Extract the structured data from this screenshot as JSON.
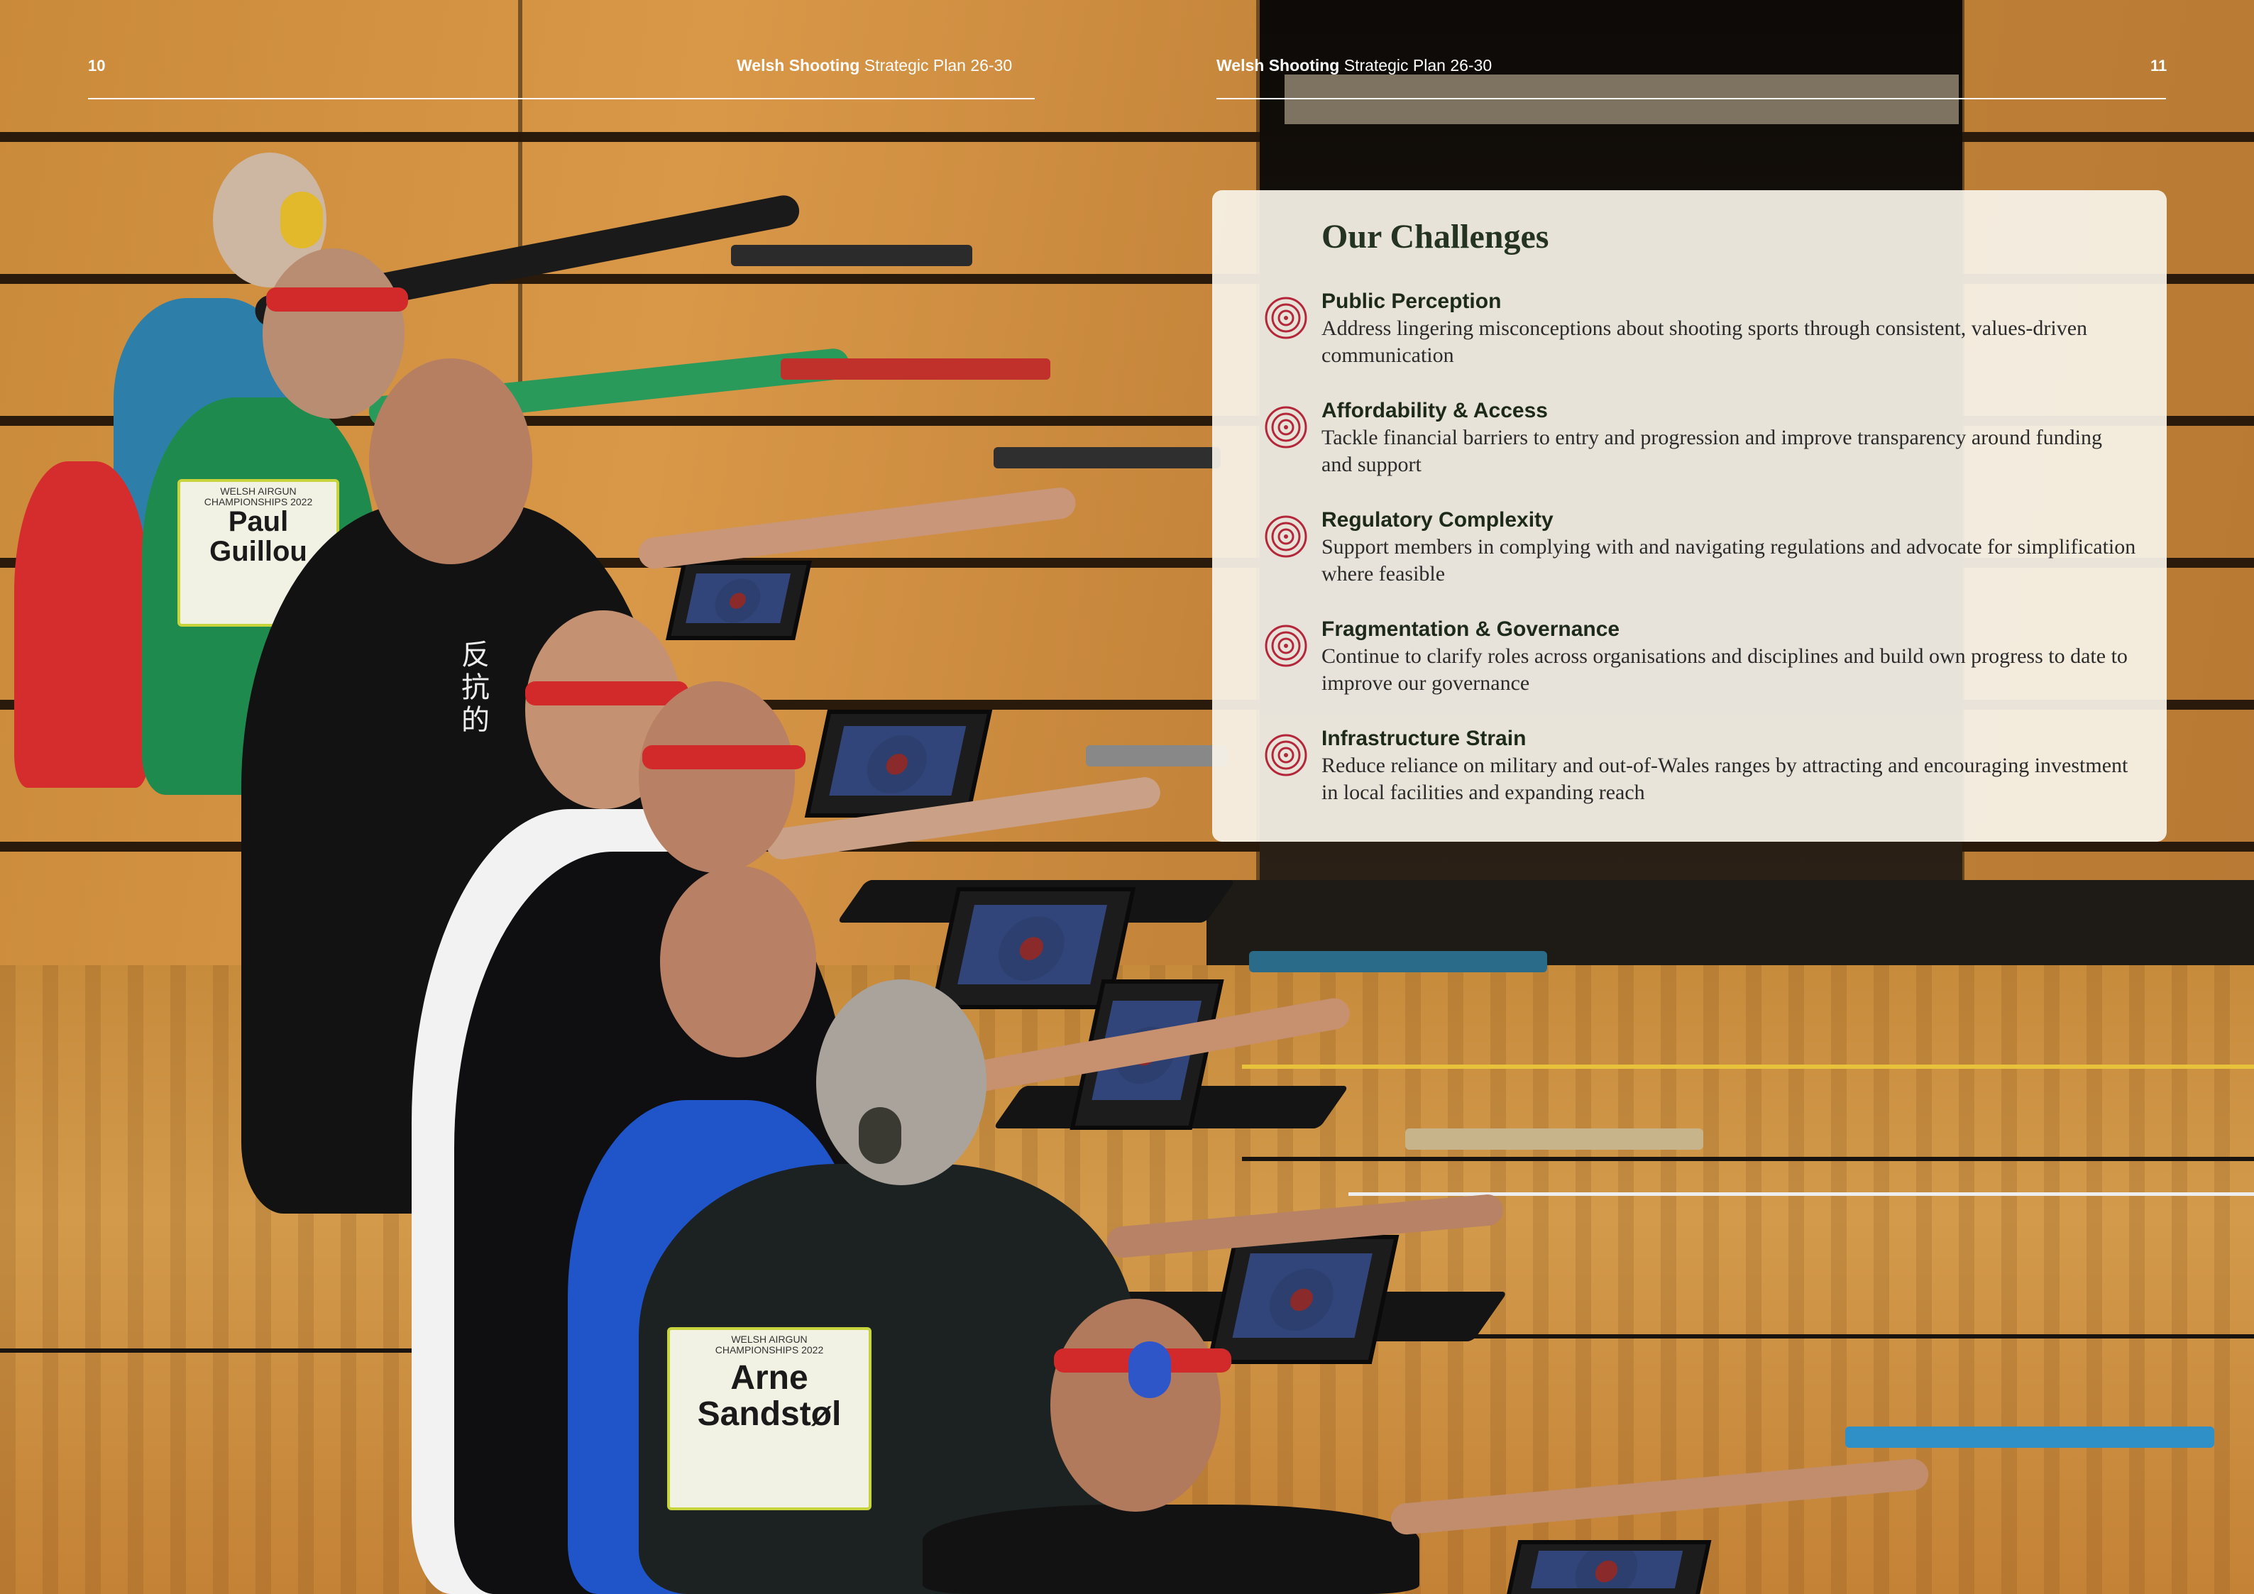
{
  "header": {
    "left_page_number": "10",
    "right_page_number": "11",
    "left_title_bold": "Welsh Shooting",
    "left_title_rest": " Strategic Plan 26-30",
    "right_title_bold": "Welsh Shooting",
    "right_title_rest": " Strategic Plan 26-30"
  },
  "photo": {
    "bibs": [
      {
        "line1": "WELSH AIRGUN",
        "line2": "CHAMPIONSHIPS 2022",
        "name1": "Paul",
        "name2": "Guillou"
      },
      {
        "line1": "WELSH AIRGUN",
        "line2": "CHAMPIONSHIPS 2022",
        "name1": "Arne",
        "name2": "Sandstøl"
      }
    ],
    "shirt_text": "反抗的"
  },
  "challenges": {
    "title": "Our Challenges",
    "icon": "target-icon",
    "accent_color": "#b4273a",
    "items": [
      {
        "heading": "Public Perception",
        "body": "Address lingering misconceptions about shooting sports through consistent, values-driven communication"
      },
      {
        "heading": "Affordability & Access",
        "body": "Tackle financial barriers to entry and progression and improve transparency around funding and support"
      },
      {
        "heading": "Regulatory Complexity",
        "body": "Support members in complying with and navigating regulations and advocate for simplification where feasible"
      },
      {
        "heading": "Fragmentation & Governance",
        "body": "Continue to clarify roles across organisations and disciplines and build own progress to date to improve our governance"
      },
      {
        "heading": "Infrastructure Strain",
        "body": "Reduce reliance on military and out-of-Wales ranges by attracting and encouraging investment in local facilities and expanding reach"
      }
    ]
  }
}
